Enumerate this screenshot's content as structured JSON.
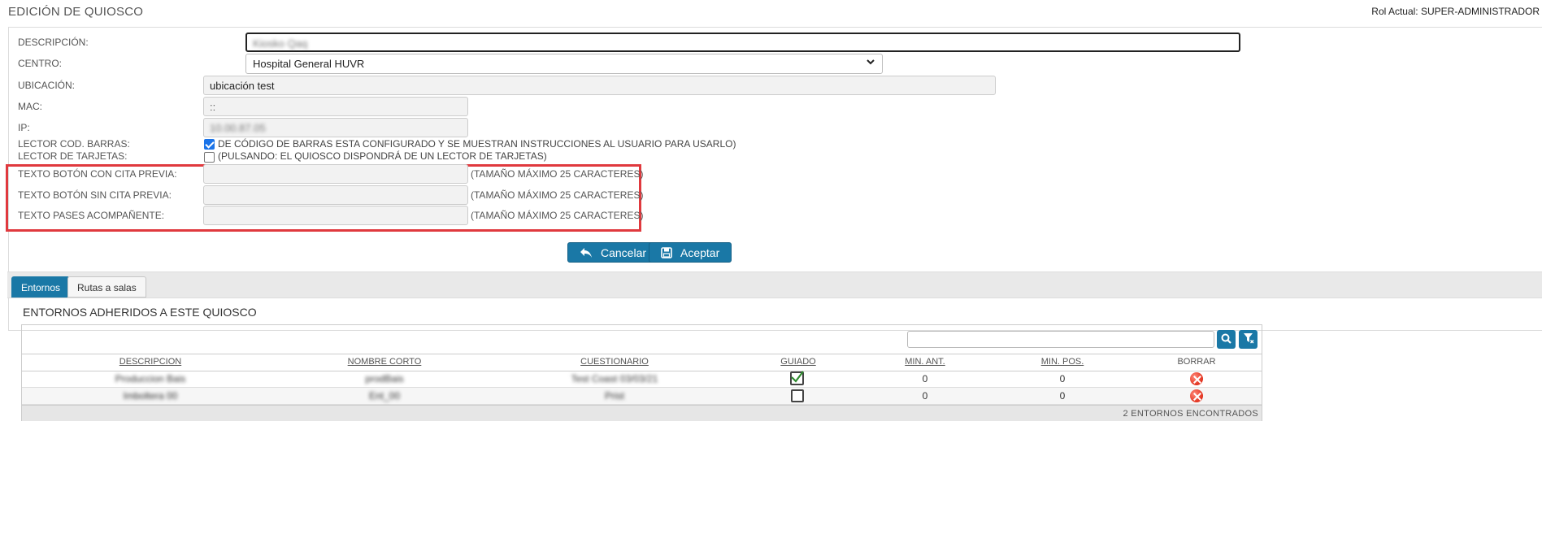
{
  "header": {
    "title": "EDICIÓN DE QUIOSCO",
    "role": "Rol Actual: SUPER-ADMINISTRADOR"
  },
  "form": {
    "descripcion": {
      "label": "DESCRIPCIÓN:",
      "value": "Kiosko Qaq"
    },
    "centro": {
      "label": "CENTRO:",
      "value": "Hospital General HUVR"
    },
    "ubicacion": {
      "label": "UBICACIÓN:",
      "value": "ubicación test"
    },
    "mac": {
      "label": "MAC:",
      "value": "::"
    },
    "ip": {
      "label": "IP:",
      "value": "10.00.87.05"
    },
    "lector_barras": {
      "label": "LECTOR COD. BARRAS:",
      "checked": true,
      "text": "DE CÓDIGO DE BARRAS ESTA CONFIGURADO Y SE MUESTRAN INSTRUCCIONES AL USUARIO PARA USARLO)"
    },
    "lector_tarjetas": {
      "label": "LECTOR DE TARJETAS:",
      "checked": false,
      "text": "(PULSANDO: EL QUIOSCO DISPONDRÁ DE UN LECTOR DE TARJETAS)"
    },
    "texto_con_cita": {
      "label": "TEXTO BOTÓN CON CITA PREVIA:",
      "value": "",
      "hint": "(TAMAÑO MÁXIMO 25 CARACTERES)"
    },
    "texto_sin_cita": {
      "label": "TEXTO BOTÓN SIN CITA PREVIA:",
      "value": "",
      "hint": "(TAMAÑO MÁXIMO 25 CARACTERES)"
    },
    "texto_pases": {
      "label": "TEXTO PASES ACOMPAÑENTE:",
      "value": "",
      "hint": "(TAMAÑO MÁXIMO 25 CARACTERES)"
    }
  },
  "actions": {
    "cancel_label": "Cancelar",
    "accept_label": "Aceptar"
  },
  "tabs": [
    {
      "label": "Entornos",
      "active": true
    },
    {
      "label": "Rutas a salas",
      "active": false
    }
  ],
  "section": {
    "title": "ENTORNOS ADHERIDOS A ESTE QUIOSCO"
  },
  "grid": {
    "search_value": "",
    "columns": [
      "DESCRIPCION",
      "NOMBRE CORTO",
      "CUESTIONARIO",
      "GUIADO",
      "MIN. ANT.",
      "MIN. POS.",
      "BORRAR"
    ],
    "rows": [
      {
        "descripcion": "Produccion Bais",
        "nombre_corto": "prodBais",
        "cuestionario": "Test Coast 03/03/21",
        "guiado": true,
        "min_ant": "0",
        "min_pos": "0"
      },
      {
        "descripcion": "Imboltera 00",
        "nombre_corto": "Ent_00",
        "cuestionario": "Prist",
        "guiado": false,
        "min_ant": "0",
        "min_pos": "0"
      }
    ],
    "footer": "2 ENTORNOS ENCONTRADOS"
  },
  "colors": {
    "primary": "#1a78a6",
    "highlight": "#e0393e",
    "delete": "#e2321e"
  }
}
